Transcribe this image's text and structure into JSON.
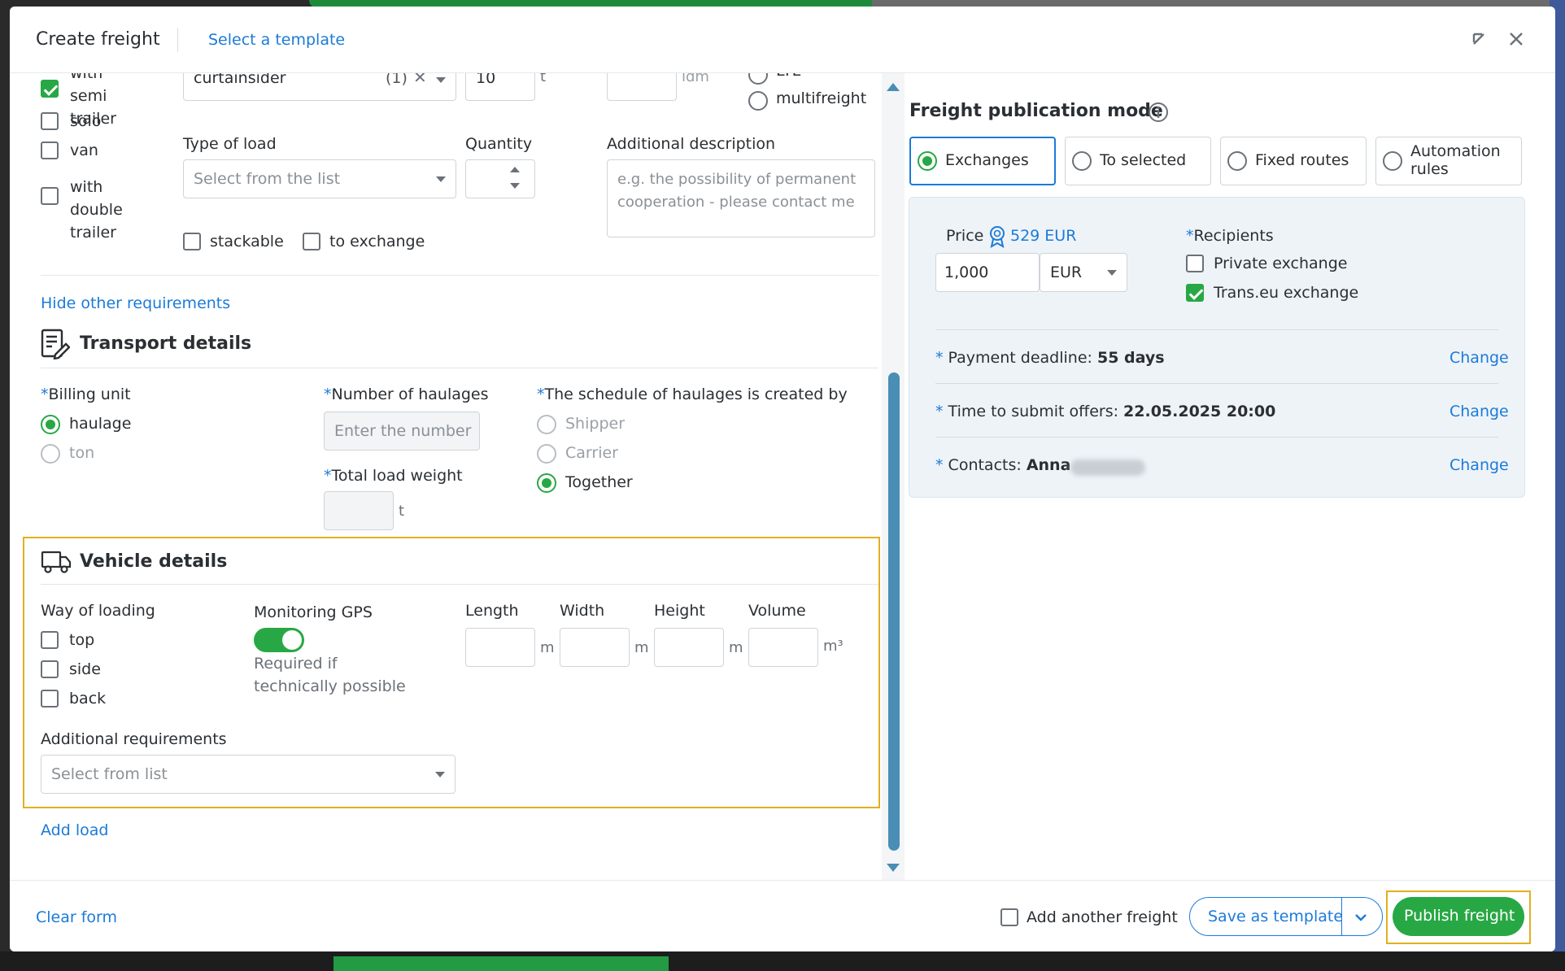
{
  "header": {
    "title": "Create freight",
    "template_link": "Select a template"
  },
  "top_partial": {
    "vehicle_options": [
      {
        "label": "with semi trailer",
        "checked": true
      },
      {
        "label": "solo",
        "checked": false
      },
      {
        "label": "van",
        "checked": false
      },
      {
        "label": "with double trailer",
        "checked": false
      }
    ],
    "body_select": {
      "value": "curtainsider",
      "count": "(1)"
    },
    "weight": {
      "value": "10",
      "unit": "t"
    },
    "ldm_unit": "ldm",
    "load_types": [
      "LTL",
      "multifreight"
    ],
    "type_of_load": {
      "label": "Type of load",
      "placeholder": "Select from the list"
    },
    "quantity": {
      "label": "Quantity"
    },
    "additional_description": {
      "label": "Additional description",
      "placeholder": "e.g. the possibility of permanent cooperation - please contact me"
    },
    "stackable": "stackable",
    "to_exchange": "to exchange"
  },
  "hide_requirements": "Hide other requirements",
  "transport": {
    "title": "Transport details",
    "billing_unit": {
      "label": "Billing unit",
      "options": [
        {
          "label": "haulage",
          "selected": true
        },
        {
          "label": "ton",
          "selected": false
        }
      ]
    },
    "haulages": {
      "label": "Number of haulages",
      "placeholder": "Enter the number"
    },
    "total_weight": {
      "label": "Total load weight",
      "unit": "t"
    },
    "schedule": {
      "label": "The schedule of haulages is created by",
      "options": [
        {
          "label": "Shipper",
          "selected": false
        },
        {
          "label": "Carrier",
          "selected": false
        },
        {
          "label": "Together",
          "selected": true
        }
      ]
    }
  },
  "vehicle": {
    "title": "Vehicle details",
    "way_of_loading": {
      "label": "Way of loading",
      "options": [
        "top",
        "side",
        "back"
      ]
    },
    "gps": {
      "label": "Monitoring GPS",
      "enabled": true,
      "note": "Required if technically possible"
    },
    "dimensions": [
      {
        "label": "Length",
        "unit": "m"
      },
      {
        "label": "Width",
        "unit": "m"
      },
      {
        "label": "Height",
        "unit": "m"
      },
      {
        "label": "Volume",
        "unit": "m³"
      }
    ],
    "additional_requirements": {
      "label": "Additional requirements",
      "placeholder": "Select from list"
    }
  },
  "add_load": "Add load",
  "publication": {
    "title": "Freight publication mode",
    "modes": [
      {
        "label": "Exchanges",
        "selected": true
      },
      {
        "label": "To selected",
        "selected": false
      },
      {
        "label": "Fixed routes",
        "selected": false
      },
      {
        "label": "Automation rules",
        "selected": false
      }
    ],
    "price": {
      "label": "Price",
      "suggested": "529 EUR",
      "value": "1,000",
      "currency": "EUR"
    },
    "recipients": {
      "label": "Recipients",
      "options": [
        {
          "label": "Private exchange",
          "checked": false
        },
        {
          "label": "Trans.eu exchange",
          "checked": true
        }
      ]
    },
    "payment_deadline": {
      "label": "Payment deadline:",
      "value": "55 days",
      "action": "Change"
    },
    "offers_time": {
      "label": "Time to submit offers:",
      "value": "22.05.2025 20:00",
      "action": "Change"
    },
    "contacts": {
      "label": "Contacts:",
      "value": "Anna",
      "action": "Change"
    }
  },
  "footer": {
    "clear": "Clear form",
    "add_another": "Add another freight",
    "save_template": "Save as template",
    "publish": "Publish freight"
  },
  "colors": {
    "accent": "#1b7bd8",
    "success": "#27a844",
    "highlight": "#e0b020"
  }
}
